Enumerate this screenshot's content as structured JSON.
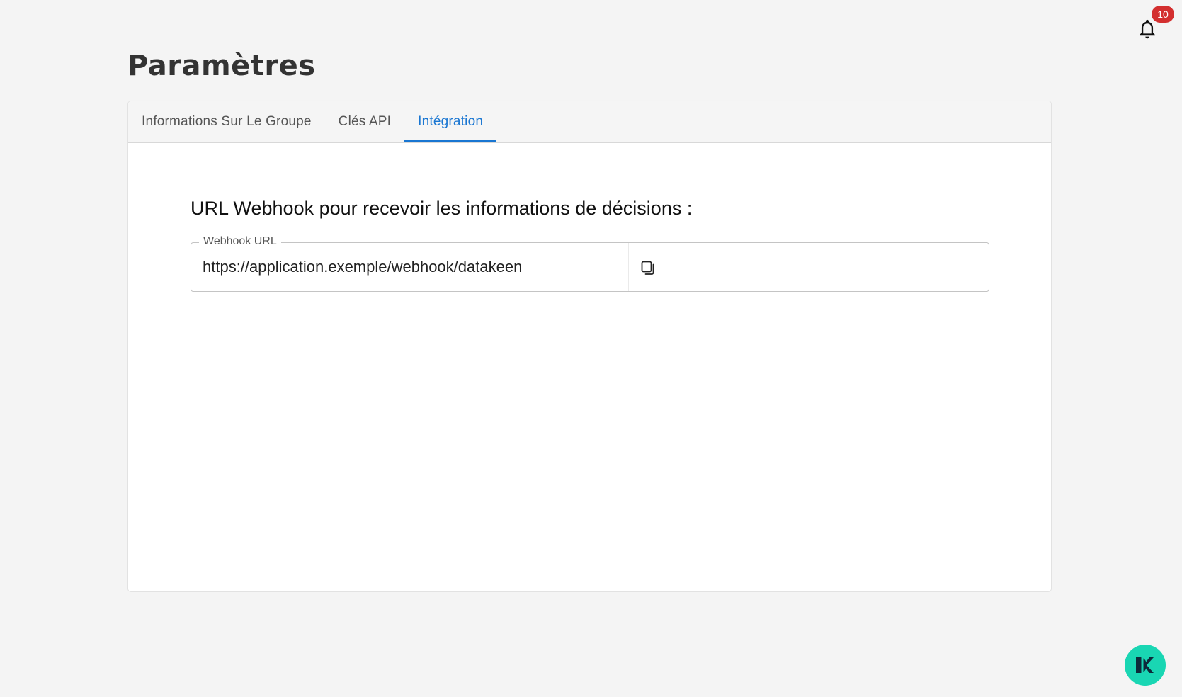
{
  "header": {
    "notification_count": "10",
    "bell_icon": "bell-icon"
  },
  "page": {
    "title": "Paramètres"
  },
  "tabs": [
    {
      "label": "Informations Sur Le Groupe",
      "active": false
    },
    {
      "label": "Clés API",
      "active": false
    },
    {
      "label": "Intégration",
      "active": true
    }
  ],
  "integration": {
    "section_title": "URL Webhook pour recevoir les informations de décisions :",
    "field_label": "Webhook URL",
    "field_value": "https://application.exemple/webhook/datakeen",
    "copy_icon": "copy-icon"
  },
  "chat": {
    "icon": "datakeen-logo-icon"
  },
  "colors": {
    "accent": "#1976d2",
    "badge": "#d32f2f",
    "fab": "#19d6b3",
    "background": "#f4f4f4"
  }
}
